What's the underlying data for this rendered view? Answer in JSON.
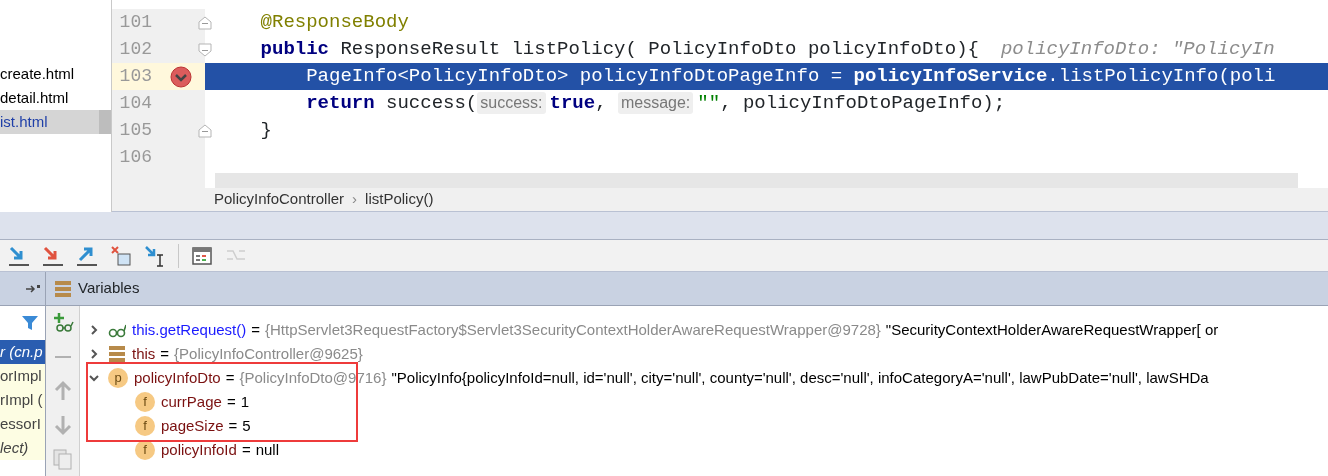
{
  "project_files": [
    {
      "name": "create.html",
      "selected": false,
      "modified": false
    },
    {
      "name": "detail.html",
      "selected": false,
      "modified": false
    },
    {
      "name": "ist.html",
      "selected": true,
      "modified": true
    }
  ],
  "editor": {
    "lines": [
      {
        "number": "101",
        "fold_open": false,
        "fold_close": true,
        "breakpoint": false,
        "current": false,
        "segments": [
          {
            "kind": "annotation",
            "text": "    @ResponseBody"
          }
        ]
      },
      {
        "number": "102",
        "fold_open": true,
        "fold_close": false,
        "breakpoint": false,
        "current": false,
        "segments": [
          {
            "kind": "keyword",
            "text": "    public"
          },
          {
            "kind": "plain",
            "text": " ResponseResult listPolicy( PolicyInfoDto policyInfoDto){"
          },
          {
            "kind": "inline-value",
            "text": "policyInfoDto: \"PolicyIn"
          }
        ]
      },
      {
        "number": "103",
        "fold_open": false,
        "fold_close": false,
        "breakpoint": true,
        "current": true,
        "segments": [
          {
            "kind": "plain",
            "text": "        PageInfo<PolicyInfoDto> policyInfoDtoPageInfo = "
          },
          {
            "kind": "field",
            "text": "policyInfoService"
          },
          {
            "kind": "plain",
            "text": ".listPolicyInfo(poli"
          }
        ]
      },
      {
        "number": "104",
        "fold_open": false,
        "fold_close": false,
        "breakpoint": false,
        "current": false,
        "segments": [
          {
            "kind": "keyword",
            "text": "        return"
          },
          {
            "kind": "plain",
            "text": " success("
          },
          {
            "kind": "hint",
            "text": "success:"
          },
          {
            "kind": "keyword",
            "text": "true"
          },
          {
            "kind": "plain",
            "text": ", "
          },
          {
            "kind": "hint",
            "text": "message:"
          },
          {
            "kind": "string",
            "text": "\"\""
          },
          {
            "kind": "plain",
            "text": ", policyInfoDtoPageInfo);"
          }
        ]
      },
      {
        "number": "105",
        "fold_open": false,
        "fold_close": true,
        "breakpoint": false,
        "current": false,
        "segments": [
          {
            "kind": "plain",
            "text": "    }"
          }
        ]
      },
      {
        "number": "106",
        "fold_open": false,
        "fold_close": false,
        "breakpoint": false,
        "current": false
      }
    ]
  },
  "breadcrumb": {
    "items": [
      "PolicyInfoController",
      "listPolicy()"
    ],
    "separator": "›"
  },
  "debug_toolbar": [
    {
      "kind": "step-into",
      "disabled": false
    },
    {
      "kind": "force-step-into",
      "disabled": false
    },
    {
      "kind": "step-out",
      "disabled": false
    },
    {
      "kind": "drop-frame",
      "disabled": false
    },
    {
      "kind": "run-to-cursor",
      "disabled": false
    },
    {
      "kind": "separator"
    },
    {
      "kind": "evaluate",
      "disabled": false
    },
    {
      "kind": "trace",
      "disabled": true
    }
  ],
  "frames_panel": {
    "frames": [
      {
        "text": "r (cn.p",
        "selected": true,
        "library": true
      },
      {
        "text": "orImpl",
        "selected": false,
        "library": false
      },
      {
        "text": "rImpl (",
        "selected": false,
        "library": false
      },
      {
        "text": "essorI",
        "selected": false,
        "library": false
      },
      {
        "text": "lect)",
        "selected": false,
        "library": true
      }
    ]
  },
  "side_toolbar": [
    {
      "kind": "add-watch",
      "disabled": false
    },
    {
      "kind": "remove",
      "disabled": true
    },
    {
      "kind": "up",
      "disabled": true
    },
    {
      "kind": "down",
      "disabled": true
    },
    {
      "kind": "copy",
      "disabled": true
    }
  ],
  "variables_panel": {
    "title": "Variables",
    "rows": [
      {
        "kind": "watch",
        "name": "this.getRequest()",
        "operator": "=",
        "ref": "{HttpServlet3RequestFactory$Servlet3SecurityContextHolderAwareRequestWrapper@9728}",
        "value": "\"SecurityContextHolderAwareRequestWrapper[ or",
        "expanded": false,
        "highlighted": false
      },
      {
        "kind": "object",
        "name": "this",
        "operator": "=",
        "ref": "{PolicyInfoController@9625}",
        "expanded": false,
        "highlighted": false
      },
      {
        "kind": "member",
        "badge": "p",
        "name": "policyInfoDto",
        "operator": "=",
        "ref": "{PolicyInfoDto@9716}",
        "value": "\"PolicyInfo{policyInfoId=null, id='null', city='null', county='null', desc='null', infoCategoryA='null', lawPubDate='null', lawSHDa",
        "expanded": true,
        "highlighted": true,
        "children": [
          {
            "kind": "member",
            "badge": "f",
            "name": "currPage",
            "operator": "=",
            "value": "1",
            "highlighted": true
          },
          {
            "kind": "member",
            "badge": "f",
            "name": "pageSize",
            "operator": "=",
            "value": "5",
            "highlighted": true
          },
          {
            "kind": "member",
            "badge": "f",
            "name": "policyInfoId",
            "operator": "=",
            "value": "null",
            "highlighted": false
          }
        ]
      }
    ]
  }
}
